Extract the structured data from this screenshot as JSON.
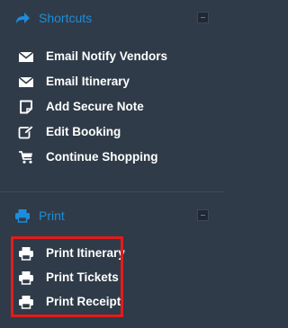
{
  "colors": {
    "background": "#2f3b48",
    "accent": "#1c8ddb",
    "item_text": "#ffffff",
    "highlight": "#e31b1b"
  },
  "shortcuts": {
    "title": "Shortcuts",
    "icon": "share-arrow-icon",
    "items": [
      {
        "label": "Email Notify Vendors",
        "icon": "envelope-icon"
      },
      {
        "label": "Email Itinerary",
        "icon": "envelope-icon"
      },
      {
        "label": "Add Secure Note",
        "icon": "note-icon"
      },
      {
        "label": "Edit Booking",
        "icon": "edit-icon"
      },
      {
        "label": "Continue Shopping",
        "icon": "cart-icon"
      }
    ]
  },
  "print": {
    "title": "Print",
    "icon": "printer-icon",
    "items": [
      {
        "label": "Print Itinerary",
        "icon": "printer-icon"
      },
      {
        "label": "Print Tickets",
        "icon": "printer-icon"
      },
      {
        "label": "Print Receipt",
        "icon": "printer-icon"
      }
    ]
  }
}
